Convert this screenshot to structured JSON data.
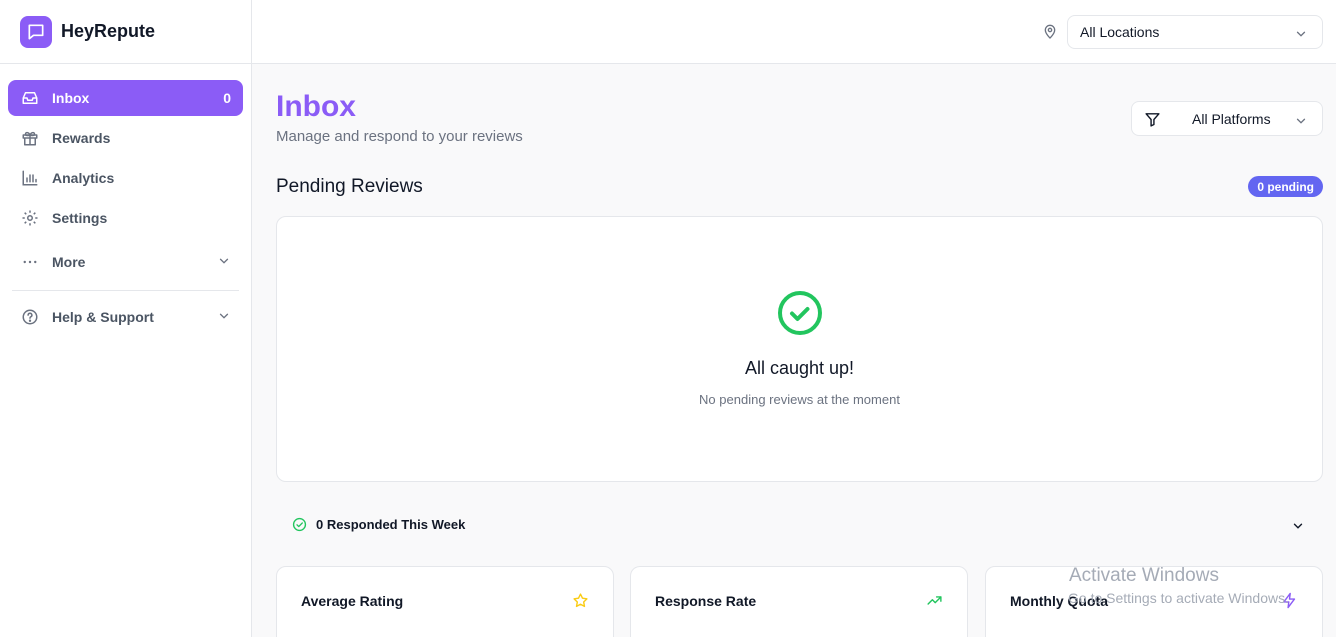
{
  "app": {
    "name": "HeyRepute"
  },
  "sidebar": {
    "items": [
      {
        "label": "Inbox",
        "count": "0",
        "icon": "inbox-icon",
        "active": true
      },
      {
        "label": "Rewards",
        "icon": "gift-icon"
      },
      {
        "label": "Analytics",
        "icon": "bar-chart-icon"
      },
      {
        "label": "Settings",
        "icon": "gear-icon"
      }
    ],
    "more": {
      "label": "More",
      "icon": "more-dots-icon"
    },
    "help": {
      "label": "Help & Support",
      "icon": "help-circle-icon"
    }
  },
  "topbar": {
    "location_select": {
      "value": "All Locations",
      "icon": "map-pin-icon"
    }
  },
  "main": {
    "title": "Inbox",
    "subtitle": "Manage and respond to your reviews",
    "platform_select": {
      "value": "All Platforms",
      "icon": "filter-icon"
    },
    "pending": {
      "title": "Pending Reviews",
      "badge": "0 pending",
      "empty_title": "All caught up!",
      "empty_subtitle": "No pending reviews at the moment"
    },
    "responded": {
      "label": "0 Responded This Week"
    },
    "stats": [
      {
        "title": "Average Rating",
        "icon": "star-icon"
      },
      {
        "title": "Response Rate",
        "icon": "trending-up-icon"
      },
      {
        "title": "Monthly Quota",
        "icon": "lightning-icon"
      }
    ]
  },
  "overlay": {
    "line1": "Activate Windows",
    "line2": "Go to Settings to activate Windows."
  },
  "colors": {
    "accent": "#8b5cf6",
    "badge": "#6366f1",
    "success": "#22c55e",
    "star": "#facc15"
  }
}
